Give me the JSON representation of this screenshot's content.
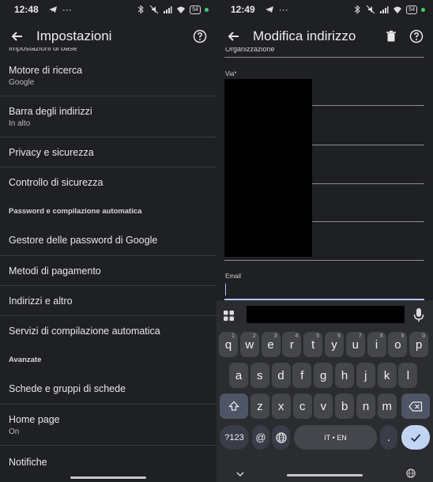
{
  "left": {
    "status": {
      "time": "12:48",
      "dots": "···",
      "battery": "54"
    },
    "appbar": {
      "title": "Impostazioni"
    },
    "cut_header": "Impostazioni di base",
    "items": [
      {
        "label": "Motore di ricerca",
        "sub": "Google"
      },
      {
        "label": "Barra degli indirizzi",
        "sub": "In alto"
      },
      {
        "label": "Privacy e sicurezza"
      },
      {
        "label": "Controllo di sicurezza"
      }
    ],
    "section_password": "Password e compilazione automatica",
    "items2": [
      {
        "label": "Gestore delle password di Google"
      },
      {
        "label": "Metodi di pagamento"
      },
      {
        "label": "Indirizzi e altro"
      },
      {
        "label": "Servizi di compilazione automatica"
      }
    ],
    "section_advanced": "Avanzate",
    "items3": [
      {
        "label": "Schede e gruppi di schede"
      },
      {
        "label": "Home page",
        "sub": "On"
      },
      {
        "label": "Notifiche"
      }
    ]
  },
  "right": {
    "status": {
      "time": "12:49",
      "dots": "···",
      "battery": "54"
    },
    "appbar": {
      "title": "Modifica indirizzo"
    },
    "cut_field": "Organizzazione",
    "via_label": "Via*",
    "email_label": "Email",
    "keyboard": {
      "row1": [
        "q",
        "w",
        "e",
        "r",
        "t",
        "y",
        "u",
        "i",
        "o",
        "p"
      ],
      "row1_hints": [
        "1",
        "2",
        "3",
        "4",
        "5",
        "6",
        "7",
        "8",
        "9",
        "0"
      ],
      "row2": [
        "a",
        "s",
        "d",
        "f",
        "g",
        "h",
        "j",
        "k",
        "l"
      ],
      "row3": [
        "z",
        "x",
        "c",
        "v",
        "b",
        "n",
        "m"
      ],
      "sym": "?123",
      "at": "@",
      "space": "IT • EN",
      "dot": "."
    }
  }
}
